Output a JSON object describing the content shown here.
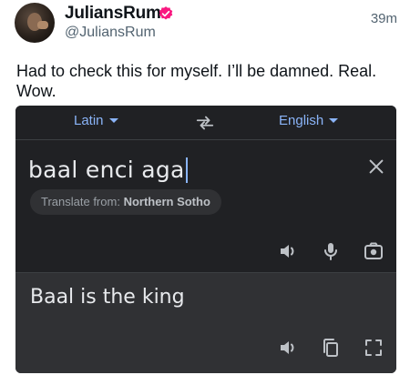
{
  "tweet": {
    "name": "JuliansRum",
    "handle": "@JuliansRum",
    "time": "39m",
    "text": "Had to check this for myself. I’ll be damned. Real. Wow."
  },
  "translator": {
    "source_lang": "Latin",
    "target_lang": "English",
    "input_text": "baal enci aga",
    "detect_prefix": "Translate from:",
    "detect_lang": "Northern Sotho",
    "output_text": "Baal is the king"
  },
  "colors": {
    "verified": "#f91880",
    "accent": "#8ab4f8",
    "panel_dark": "#202124",
    "panel_result": "#303134"
  },
  "icons": [
    "verified-icon",
    "swap-icon",
    "close-icon",
    "speaker-icon",
    "microphone-icon",
    "camera-icon",
    "copy-icon",
    "fullscreen-icon"
  ]
}
